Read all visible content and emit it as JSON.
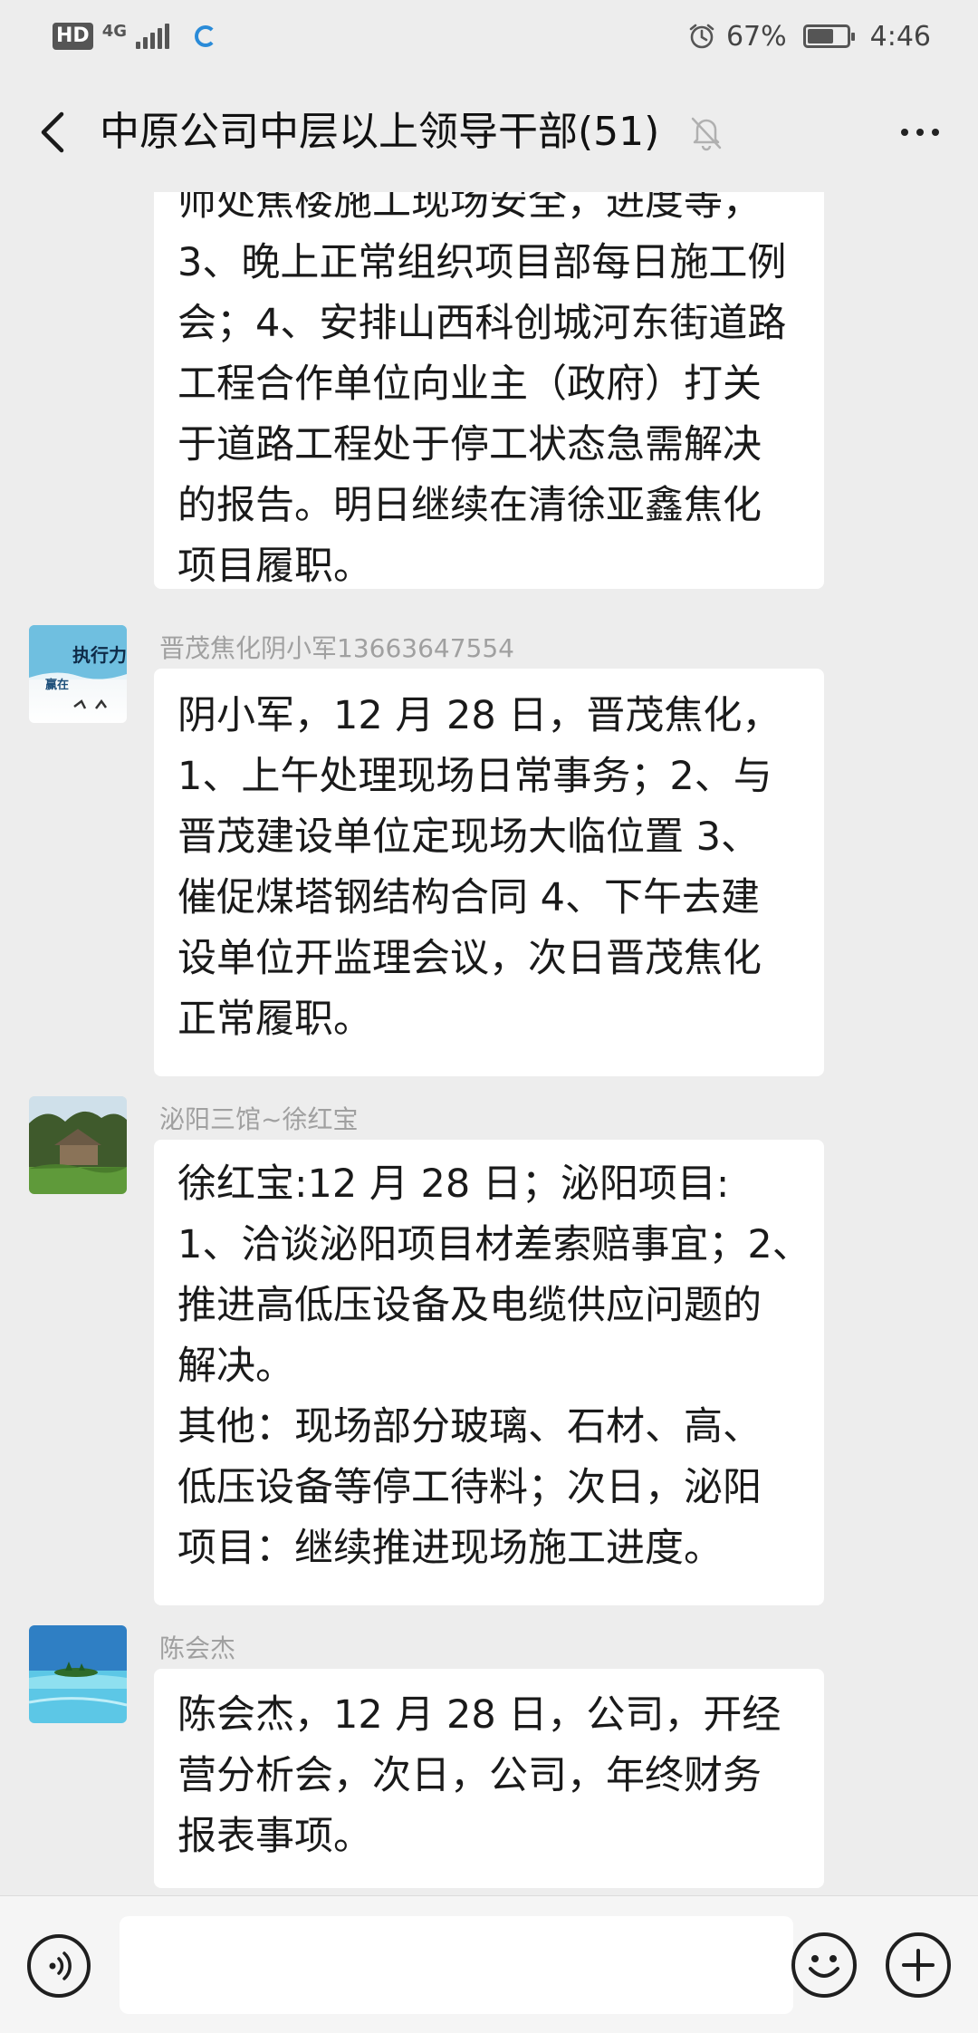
{
  "status_bar": {
    "hd": "HD",
    "network": "4G",
    "battery_percent": "67%",
    "battery_level": 0.67,
    "time": "4:46"
  },
  "title_bar": {
    "title": "中原公司中层以上领导干部(51)",
    "muted": true
  },
  "messages": [
    {
      "sender": "",
      "lines": [
        "师处焦楼施工现场安全，进度等，",
        "3、晚上正常组织项目部每日施工例",
        "会；4、安排山西科创城河东街道路",
        "工程合作单位向业主（政府）打关",
        "于道路工程处于停工状态急需解决",
        "的报告。明日继续在清徐亚鑫焦化",
        "项目履职。"
      ]
    },
    {
      "sender": "晋茂焦化阴小军13663647554",
      "avatar_text": {
        "big1": "执行力",
        "small": "赢在"
      },
      "lines": [
        "阴小军，12 月 28 日，晋茂焦化，",
        "1、上午处理现场日常事务；2、与",
        "晋茂建设单位定现场大临位置 3、",
        "催促煤塔钢结构合同 4、下午去建",
        "设单位开监理会议，次日晋茂焦化",
        "正常履职。"
      ]
    },
    {
      "sender": "泌阳三馆~徐红宝",
      "lines": [
        "徐红宝:12 月 28 日；泌阳项目:",
        "1、洽谈泌阳项目材差索赔事宜；2、",
        "推进高低压设备及电缆供应问题的",
        "解决。",
        "其他：现场部分玻璃、石材、高、",
        "低压设备等停工待料；次日，泌阳",
        "项目：继续推进现场施工进度。"
      ]
    },
    {
      "sender": "陈会杰",
      "lines": [
        "陈会杰，12 月 28 日，公司，开经",
        "营分析会，次日，公司，年终财务",
        "报表事项。"
      ]
    }
  ],
  "colors": {
    "background": "#ededed",
    "bubble": "#ffffff",
    "sender_name": "#a0a0a0",
    "text": "#1a1a1a"
  },
  "icons": {
    "back": "chevron-left-icon",
    "mute": "bell-off-icon",
    "more": "more-dots-icon",
    "voice": "voice-icon",
    "emoji": "emoji-icon",
    "plus": "plus-icon"
  }
}
